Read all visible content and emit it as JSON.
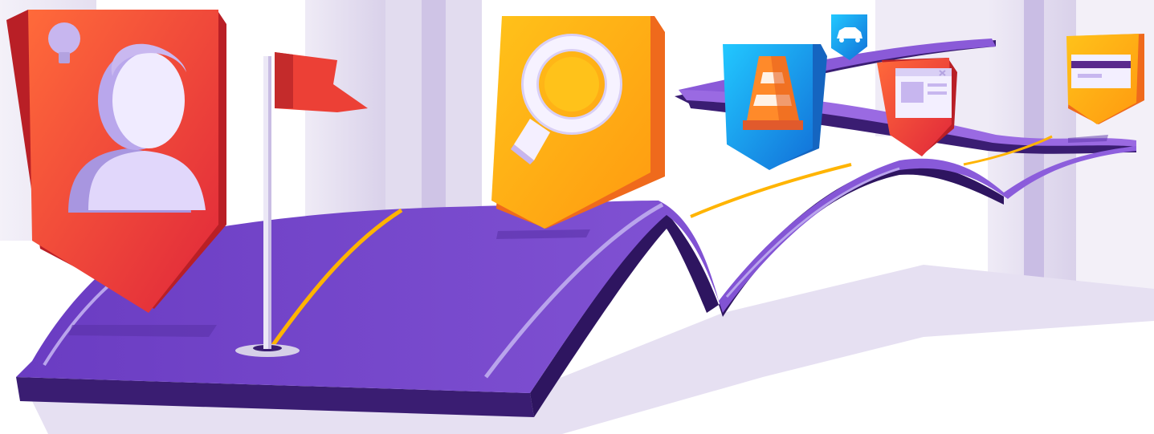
{
  "scene": {
    "kind": "illustration",
    "theme": "roadmap journey along a winding purple road"
  },
  "colors": {
    "background": "#ffffff",
    "pillar": "#ece8f4",
    "pillar_shade": "#d8d0ea",
    "road_top": "#6c3fc4",
    "road_top_far": "#8a5ad8",
    "road_side": "#3a1d72",
    "road_edge_line": "#b9a4ec",
    "center_line": "#ffb400",
    "ground_shadow": "#e4def1",
    "red_badge": "#ee4337",
    "red_badge_side": "#b91f26",
    "yellow_badge": "#ffb413",
    "yellow_badge_side": "#ef6a1c",
    "blue_badge": "#1aa0f0",
    "blue_badge_side": "#1565c0",
    "figure": "#c7b6ef",
    "flag": "#ec4036"
  },
  "milestones": [
    {
      "id": "start-flag",
      "icon": "flag-icon"
    },
    {
      "id": "profile",
      "icon": "user-icon",
      "extra_icon": "lightbulb-icon",
      "color": "red"
    },
    {
      "id": "search",
      "icon": "magnifier-icon",
      "color": "yellow"
    },
    {
      "id": "obstacle",
      "icon": "traffic-cone-icon",
      "color": "blue"
    },
    {
      "id": "transport",
      "icon": "car-icon",
      "color": "blue"
    },
    {
      "id": "document",
      "icon": "browser-window-icon",
      "color": "red"
    },
    {
      "id": "payment",
      "icon": "credit-card-icon",
      "color": "yellow"
    }
  ]
}
